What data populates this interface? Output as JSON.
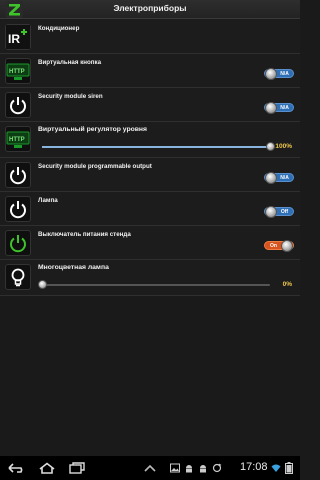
{
  "header": {
    "title": "Электроприборы",
    "logo_icon": "z-logo-icon"
  },
  "devices": [
    {
      "name": "Кондиционер",
      "icon": "ir-icon",
      "control": "none"
    },
    {
      "name": "Виртуальная кнопка",
      "icon": "http-icon",
      "control": "toggle",
      "state_label": "N/A",
      "state": "off"
    },
    {
      "name": "Security module siren",
      "icon": "power-icon",
      "control": "toggle",
      "state_label": "N/A",
      "state": "off"
    },
    {
      "name": "Виртуальный регулятор уровня",
      "icon": "http-icon",
      "control": "slider",
      "value_label": "100%",
      "level": 1.0
    },
    {
      "name": "Security module programmable output",
      "icon": "power-icon",
      "control": "toggle",
      "state_label": "N/A",
      "state": "off"
    },
    {
      "name": "Лампа",
      "icon": "power-icon",
      "control": "toggle",
      "state_label": "Off",
      "state": "off"
    },
    {
      "name": "Выключатель питания стенда",
      "icon": "power-green-icon",
      "control": "toggle",
      "state_label": "On",
      "state": "on"
    },
    {
      "name": "Многоцветная лампа",
      "icon": "bulb-icon",
      "control": "slider",
      "value_label": "0%",
      "level": 0.0
    }
  ],
  "navbar": {
    "clock": "17:08",
    "buttons": [
      "back-icon",
      "home-icon",
      "recent-apps-icon"
    ],
    "status_icons": [
      "image-icon",
      "android-icon",
      "android-icon",
      "sync-icon",
      "wifi-icon",
      "battery-icon"
    ]
  },
  "colors": {
    "toggle_off": "#2f6fb5",
    "toggle_on": "#d9531e",
    "slider_value": "#f2c94c",
    "logo": "#3ec42a",
    "http_badge": "#1a9a2a"
  }
}
